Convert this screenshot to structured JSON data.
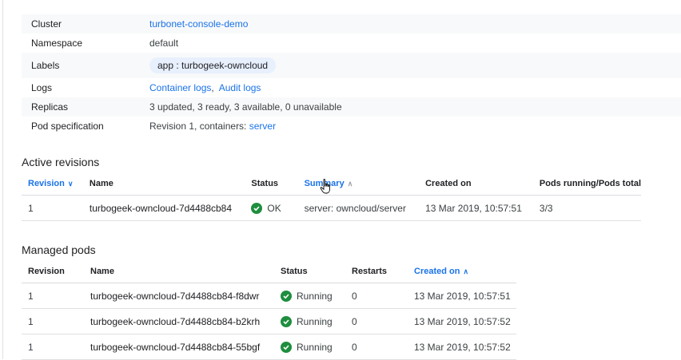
{
  "details": [
    {
      "key": "Cluster",
      "value": "turbonet-console-demo",
      "type": "link"
    },
    {
      "key": "Namespace",
      "value": "default",
      "type": "text"
    },
    {
      "key": "Labels",
      "value": "app : turbogeek-owncloud",
      "type": "chip"
    },
    {
      "key": "Logs",
      "links": [
        "Container logs",
        "Audit logs"
      ],
      "separator": ",",
      "type": "links"
    },
    {
      "key": "Replicas",
      "value": "3 updated, 3 ready, 3 available, 0 unavailable",
      "type": "text"
    },
    {
      "key": "Pod specification",
      "prefix": "Revision 1, containers: ",
      "link": "server",
      "type": "mixed"
    }
  ],
  "active_revisions": {
    "title": "Active revisions",
    "columns": [
      "Revision",
      "Name",
      "Status",
      "Summary",
      "Created on",
      "Pods running/Pods total"
    ],
    "rows": [
      {
        "revision": "1",
        "name": "turbogeek-owncloud-7d4488cb84",
        "status": "OK",
        "summary": "server: owncloud/server",
        "created": "13 Mar 2019, 10:57:51",
        "pods": "3/3"
      }
    ]
  },
  "managed_pods": {
    "title": "Managed pods",
    "columns": [
      "Revision",
      "Name",
      "Status",
      "Restarts",
      "Created on"
    ],
    "rows": [
      {
        "revision": "1",
        "name": "turbogeek-owncloud-7d4488cb84-f8dwr",
        "status": "Running",
        "restarts": "0",
        "created": "13 Mar 2019, 10:57:51"
      },
      {
        "revision": "1",
        "name": "turbogeek-owncloud-7d4488cb84-b2krh",
        "status": "Running",
        "restarts": "0",
        "created": "13 Mar 2019, 10:57:52"
      },
      {
        "revision": "1",
        "name": "turbogeek-owncloud-7d4488cb84-55bgf",
        "status": "Running",
        "restarts": "0",
        "created": "13 Mar 2019, 10:57:52"
      }
    ]
  },
  "colors": {
    "link": "#1a73e8",
    "ok": "#1e8e3e",
    "chip": "#e8f0fe"
  },
  "icons": [
    "check-circle-icon",
    "sort-arrow-icon",
    "hand-cursor-icon"
  ]
}
